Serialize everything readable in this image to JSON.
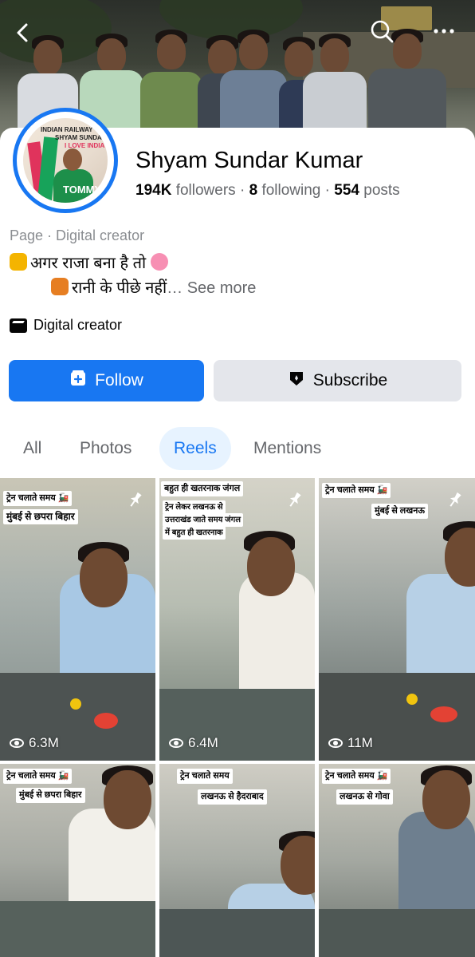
{
  "header": {
    "back_icon": "back-chevron-icon",
    "search_icon": "search-icon",
    "more_icon": "more-horizontal-icon"
  },
  "avatar": {
    "line1": "INDIAN RAILWAY",
    "line2": "SHYAM SUNDAR",
    "line3": "I LOVE INDIA",
    "line4": "TOMMY"
  },
  "profile": {
    "name": "Shyam Sundar Kumar",
    "followers_count": "194K",
    "followers_label": "followers",
    "following_count": "8",
    "following_label": "following",
    "posts_count": "554",
    "posts_label": "posts",
    "separator": " · ",
    "category": "Page · Digital creator",
    "bio_line1": "अगर राजा बना है तो",
    "bio_line2": "रानी के पीछे नहीं",
    "see_more": "… See more",
    "creator_label": "Digital creator"
  },
  "buttons": {
    "follow": "Follow",
    "subscribe": "Subscribe"
  },
  "tabs": [
    "All",
    "Photos",
    "Reels",
    "Mentions"
  ],
  "active_tab": "Reels",
  "reels": [
    {
      "captions": [
        "ट्रेन चलाते समय 🚂",
        "मुंबई से छपरा बिहार"
      ],
      "views": "6.3M",
      "pinned": true
    },
    {
      "captions": [
        "बहुत ही खतरनाक जंगल",
        "ट्रेन लेकर लखनऊ से",
        "उत्तराखंड जाते समय जंगल",
        "में बहुत ही खतरनाक"
      ],
      "views": "6.4M",
      "pinned": true
    },
    {
      "captions": [
        "ट्रेन चलाते समय 🚂",
        "मुंबई से लखनऊ"
      ],
      "views": "11M",
      "pinned": true
    },
    {
      "captions": [
        "ट्रेन चलाते समय 🚂",
        "मुंबई से छपरा बिहार"
      ],
      "views": "",
      "pinned": false
    },
    {
      "captions": [
        "ट्रेन चलाते समय",
        "लखनऊ से हैदराबाद"
      ],
      "views": "",
      "pinned": false
    },
    {
      "captions": [
        "ट्रेन चलाते समय 🚂",
        "लखनऊ से गोवा"
      ],
      "views": "",
      "pinned": false
    }
  ],
  "colors": {
    "accent": "#1877f2",
    "secondary_text": "#65676b",
    "button_gray": "#e4e6eb",
    "active_tab_bg": "#e7f3ff"
  }
}
